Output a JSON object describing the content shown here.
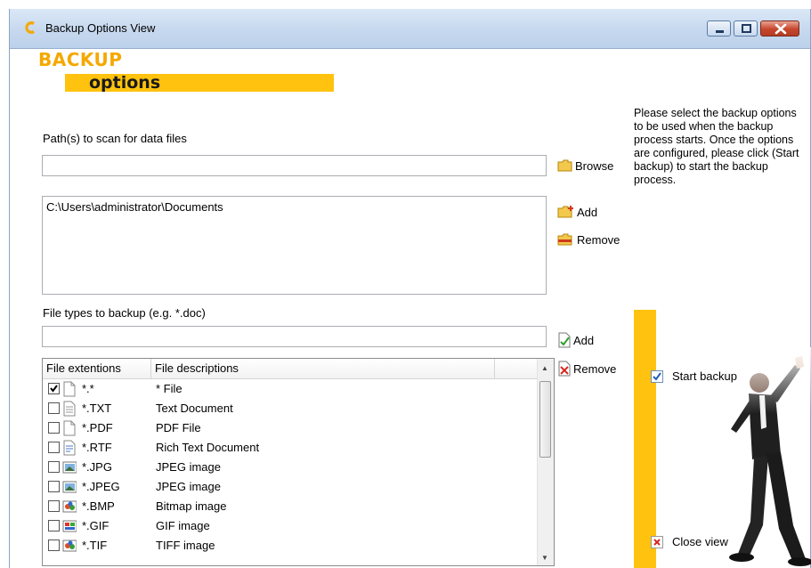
{
  "window": {
    "title": "Backup Options View"
  },
  "logo": {
    "line1": "BACKUP",
    "line2": "options"
  },
  "paths": {
    "label": "Path(s) to scan for data files",
    "input_value": "",
    "browse_label": "Browse",
    "list": [
      "C:\\Users\\administrator\\Documents"
    ],
    "add_label": "Add",
    "remove_label": "Remove"
  },
  "filetypes": {
    "label": "File types to backup (e.g. *.doc)",
    "input_value": "",
    "add_label": "Add",
    "remove_label": "Remove",
    "columns": [
      "File extentions",
      "File descriptions"
    ],
    "rows": [
      {
        "checked": true,
        "icon": "blank-file-icon",
        "ext": "*.*",
        "desc": "* File"
      },
      {
        "checked": false,
        "icon": "text-file-icon",
        "ext": "*.TXT",
        "desc": "Text Document"
      },
      {
        "checked": false,
        "icon": "blank-file-icon",
        "ext": "*.PDF",
        "desc": "PDF File"
      },
      {
        "checked": false,
        "icon": "rtf-file-icon",
        "ext": "*.RTF",
        "desc": "Rich Text Document"
      },
      {
        "checked": false,
        "icon": "image-file-icon",
        "ext": "*.JPG",
        "desc": "JPEG image"
      },
      {
        "checked": false,
        "icon": "image-file-icon",
        "ext": "*.JPEG",
        "desc": "JPEG image"
      },
      {
        "checked": false,
        "icon": "paint-file-icon",
        "ext": "*.BMP",
        "desc": "Bitmap image"
      },
      {
        "checked": false,
        "icon": "gif-file-icon",
        "ext": "*.GIF",
        "desc": "GIF image"
      },
      {
        "checked": false,
        "icon": "paint-file-icon",
        "ext": "*.TIF",
        "desc": "TIFF image"
      }
    ]
  },
  "info": {
    "text": "Please select the backup options to be used when the backup process starts. Once the options are configured, please click (Start backup) to start the backup process."
  },
  "actions": {
    "start_label": "Start backup",
    "close_label": "Close view"
  },
  "colors": {
    "accent": "#ffc20e",
    "logo_orange": "#f5a800"
  }
}
